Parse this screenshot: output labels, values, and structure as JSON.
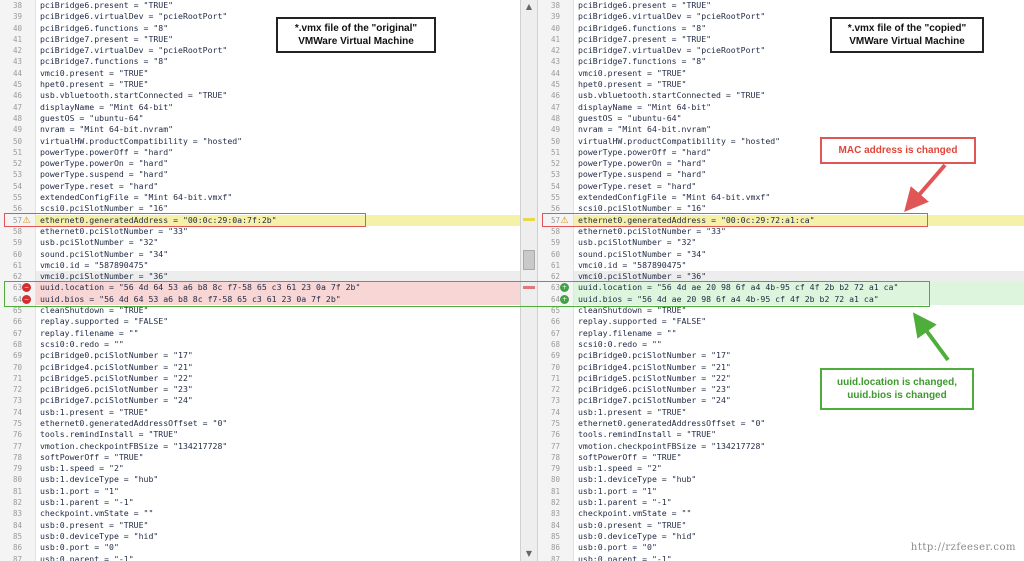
{
  "left": {
    "lines": [
      {
        "n": "38",
        "t": "pciBridge6.present = \"TRUE\"",
        "s": "",
        "m": ""
      },
      {
        "n": "39",
        "t": "pciBridge6.virtualDev = \"pcieRootPort\"",
        "s": "",
        "m": ""
      },
      {
        "n": "40",
        "t": "pciBridge6.functions = \"8\"",
        "s": "",
        "m": ""
      },
      {
        "n": "41",
        "t": "pciBridge7.present = \"TRUE\"",
        "s": "",
        "m": ""
      },
      {
        "n": "42",
        "t": "pciBridge7.virtualDev = \"pcieRootPort\"",
        "s": "",
        "m": ""
      },
      {
        "n": "43",
        "t": "pciBridge7.functions = \"8\"",
        "s": "",
        "m": ""
      },
      {
        "n": "44",
        "t": "vmci0.present = \"TRUE\"",
        "s": "",
        "m": ""
      },
      {
        "n": "45",
        "t": "hpet0.present = \"TRUE\"",
        "s": "",
        "m": ""
      },
      {
        "n": "46",
        "t": "usb.vbluetooth.startConnected = \"TRUE\"",
        "s": "",
        "m": ""
      },
      {
        "n": "47",
        "t": "displayName = \"Mint 64-bit\"",
        "s": "",
        "m": ""
      },
      {
        "n": "48",
        "t": "guestOS = \"ubuntu-64\"",
        "s": "",
        "m": ""
      },
      {
        "n": "49",
        "t": "nvram = \"Mint 64-bit.nvram\"",
        "s": "",
        "m": ""
      },
      {
        "n": "50",
        "t": "virtualHW.productCompatibility = \"hosted\"",
        "s": "",
        "m": ""
      },
      {
        "n": "51",
        "t": "powerType.powerOff = \"hard\"",
        "s": "",
        "m": ""
      },
      {
        "n": "52",
        "t": "powerType.powerOn = \"hard\"",
        "s": "",
        "m": ""
      },
      {
        "n": "53",
        "t": "powerType.suspend = \"hard\"",
        "s": "",
        "m": ""
      },
      {
        "n": "54",
        "t": "powerType.reset = \"hard\"",
        "s": "",
        "m": ""
      },
      {
        "n": "55",
        "t": "extendedConfigFile = \"Mint 64-bit.vmxf\"",
        "s": "",
        "m": ""
      },
      {
        "n": "56",
        "t": "scsi0.pciSlotNumber = \"16\"",
        "s": "",
        "m": ""
      },
      {
        "n": "57",
        "t": "ethernet0.generatedAddress = \"00:0c:29:0a:7f:2b\"",
        "s": "yellow",
        "m": "warn"
      },
      {
        "n": "58",
        "t": "ethernet0.pciSlotNumber = \"33\"",
        "s": "",
        "m": ""
      },
      {
        "n": "59",
        "t": "usb.pciSlotNumber = \"32\"",
        "s": "",
        "m": ""
      },
      {
        "n": "60",
        "t": "sound.pciSlotNumber = \"34\"",
        "s": "",
        "m": ""
      },
      {
        "n": "61",
        "t": "vmci0.id = \"587890475\"",
        "s": "",
        "m": ""
      },
      {
        "n": "62",
        "t": "vmci0.pciSlotNumber = \"36\"",
        "s": "grey",
        "m": ""
      },
      {
        "n": "63",
        "t": "uuid.location = \"56 4d 64 53 a6 b8 8c f7-58 65 c3 61 23 0a 7f 2b\"",
        "s": "pink",
        "m": "removed"
      },
      {
        "n": "64",
        "t": "uuid.bios = \"56 4d 64 53 a6 b8 8c f7-58 65 c3 61 23 0a 7f 2b\"",
        "s": "pink",
        "m": "removed"
      },
      {
        "n": "65",
        "t": "cleanShutdown = \"TRUE\"",
        "s": "",
        "m": ""
      },
      {
        "n": "66",
        "t": "replay.supported = \"FALSE\"",
        "s": "",
        "m": ""
      },
      {
        "n": "67",
        "t": "replay.filename = \"\"",
        "s": "",
        "m": ""
      },
      {
        "n": "68",
        "t": "scsi0:0.redo = \"\"",
        "s": "",
        "m": ""
      },
      {
        "n": "69",
        "t": "pciBridge0.pciSlotNumber = \"17\"",
        "s": "",
        "m": ""
      },
      {
        "n": "70",
        "t": "pciBridge4.pciSlotNumber = \"21\"",
        "s": "",
        "m": ""
      },
      {
        "n": "71",
        "t": "pciBridge5.pciSlotNumber = \"22\"",
        "s": "",
        "m": ""
      },
      {
        "n": "72",
        "t": "pciBridge6.pciSlotNumber = \"23\"",
        "s": "",
        "m": ""
      },
      {
        "n": "73",
        "t": "pciBridge7.pciSlotNumber = \"24\"",
        "s": "",
        "m": ""
      },
      {
        "n": "74",
        "t": "usb:1.present = \"TRUE\"",
        "s": "",
        "m": ""
      },
      {
        "n": "75",
        "t": "ethernet0.generatedAddressOffset = \"0\"",
        "s": "",
        "m": ""
      },
      {
        "n": "76",
        "t": "tools.remindInstall = \"TRUE\"",
        "s": "",
        "m": ""
      },
      {
        "n": "77",
        "t": "vmotion.checkpointFBSize = \"134217728\"",
        "s": "",
        "m": ""
      },
      {
        "n": "78",
        "t": "softPowerOff = \"TRUE\"",
        "s": "",
        "m": ""
      },
      {
        "n": "79",
        "t": "usb:1.speed = \"2\"",
        "s": "",
        "m": ""
      },
      {
        "n": "80",
        "t": "usb:1.deviceType = \"hub\"",
        "s": "",
        "m": ""
      },
      {
        "n": "81",
        "t": "usb:1.port = \"1\"",
        "s": "",
        "m": ""
      },
      {
        "n": "82",
        "t": "usb:1.parent = \"-1\"",
        "s": "",
        "m": ""
      },
      {
        "n": "83",
        "t": "checkpoint.vmState = \"\"",
        "s": "",
        "m": ""
      },
      {
        "n": "84",
        "t": "usb:0.present = \"TRUE\"",
        "s": "",
        "m": ""
      },
      {
        "n": "85",
        "t": "usb:0.deviceType = \"hid\"",
        "s": "",
        "m": ""
      },
      {
        "n": "86",
        "t": "usb:0.port = \"0\"",
        "s": "",
        "m": ""
      },
      {
        "n": "87",
        "t": "usb:0.parent = \"-1\"",
        "s": "",
        "m": ""
      }
    ]
  },
  "right": {
    "lines": [
      {
        "n": "38",
        "t": "pciBridge6.present = \"TRUE\"",
        "s": "",
        "m": ""
      },
      {
        "n": "39",
        "t": "pciBridge6.virtualDev = \"pcieRootPort\"",
        "s": "",
        "m": ""
      },
      {
        "n": "40",
        "t": "pciBridge6.functions = \"8\"",
        "s": "",
        "m": ""
      },
      {
        "n": "41",
        "t": "pciBridge7.present = \"TRUE\"",
        "s": "",
        "m": ""
      },
      {
        "n": "42",
        "t": "pciBridge7.virtualDev = \"pcieRootPort\"",
        "s": "",
        "m": ""
      },
      {
        "n": "43",
        "t": "pciBridge7.functions = \"8\"",
        "s": "",
        "m": ""
      },
      {
        "n": "44",
        "t": "vmci0.present = \"TRUE\"",
        "s": "",
        "m": ""
      },
      {
        "n": "45",
        "t": "hpet0.present = \"TRUE\"",
        "s": "",
        "m": ""
      },
      {
        "n": "46",
        "t": "usb.vbluetooth.startConnected = \"TRUE\"",
        "s": "",
        "m": ""
      },
      {
        "n": "47",
        "t": "displayName = \"Mint 64-bit\"",
        "s": "",
        "m": ""
      },
      {
        "n": "48",
        "t": "guestOS = \"ubuntu-64\"",
        "s": "",
        "m": ""
      },
      {
        "n": "49",
        "t": "nvram = \"Mint 64-bit.nvram\"",
        "s": "",
        "m": ""
      },
      {
        "n": "50",
        "t": "virtualHW.productCompatibility = \"hosted\"",
        "s": "",
        "m": ""
      },
      {
        "n": "51",
        "t": "powerType.powerOff = \"hard\"",
        "s": "",
        "m": ""
      },
      {
        "n": "52",
        "t": "powerType.powerOn = \"hard\"",
        "s": "",
        "m": ""
      },
      {
        "n": "53",
        "t": "powerType.suspend = \"hard\"",
        "s": "",
        "m": ""
      },
      {
        "n": "54",
        "t": "powerType.reset = \"hard\"",
        "s": "",
        "m": ""
      },
      {
        "n": "55",
        "t": "extendedConfigFile = \"Mint 64-bit.vmxf\"",
        "s": "",
        "m": ""
      },
      {
        "n": "56",
        "t": "scsi0.pciSlotNumber = \"16\"",
        "s": "",
        "m": ""
      },
      {
        "n": "57",
        "t": "ethernet0.generatedAddress = \"00:0c:29:72:a1:ca\"",
        "s": "yellow",
        "m": "warn"
      },
      {
        "n": "58",
        "t": "ethernet0.pciSlotNumber = \"33\"",
        "s": "",
        "m": ""
      },
      {
        "n": "59",
        "t": "usb.pciSlotNumber = \"32\"",
        "s": "",
        "m": ""
      },
      {
        "n": "60",
        "t": "sound.pciSlotNumber = \"34\"",
        "s": "",
        "m": ""
      },
      {
        "n": "61",
        "t": "vmci0.id = \"587890475\"",
        "s": "",
        "m": ""
      },
      {
        "n": "62",
        "t": "vmci0.pciSlotNumber = \"36\"",
        "s": "grey",
        "m": ""
      },
      {
        "n": "63",
        "t": "uuid.location = \"56 4d ae 20 98 6f a4 4b-95 cf 4f 2b b2 72 a1 ca\"",
        "s": "green",
        "m": "added"
      },
      {
        "n": "64",
        "t": "uuid.bios = \"56 4d ae 20 98 6f a4 4b-95 cf 4f 2b b2 72 a1 ca\"",
        "s": "green",
        "m": "added"
      },
      {
        "n": "65",
        "t": "cleanShutdown = \"TRUE\"",
        "s": "",
        "m": ""
      },
      {
        "n": "66",
        "t": "replay.supported = \"FALSE\"",
        "s": "",
        "m": ""
      },
      {
        "n": "67",
        "t": "replay.filename = \"\"",
        "s": "",
        "m": ""
      },
      {
        "n": "68",
        "t": "scsi0:0.redo = \"\"",
        "s": "",
        "m": ""
      },
      {
        "n": "69",
        "t": "pciBridge0.pciSlotNumber = \"17\"",
        "s": "",
        "m": ""
      },
      {
        "n": "70",
        "t": "pciBridge4.pciSlotNumber = \"21\"",
        "s": "",
        "m": ""
      },
      {
        "n": "71",
        "t": "pciBridge5.pciSlotNumber = \"22\"",
        "s": "",
        "m": ""
      },
      {
        "n": "72",
        "t": "pciBridge6.pciSlotNumber = \"23\"",
        "s": "",
        "m": ""
      },
      {
        "n": "73",
        "t": "pciBridge7.pciSlotNumber = \"24\"",
        "s": "",
        "m": ""
      },
      {
        "n": "74",
        "t": "usb:1.present = \"TRUE\"",
        "s": "",
        "m": ""
      },
      {
        "n": "75",
        "t": "ethernet0.generatedAddressOffset = \"0\"",
        "s": "",
        "m": ""
      },
      {
        "n": "76",
        "t": "tools.remindInstall = \"TRUE\"",
        "s": "",
        "m": ""
      },
      {
        "n": "77",
        "t": "vmotion.checkpointFBSize = \"134217728\"",
        "s": "",
        "m": ""
      },
      {
        "n": "78",
        "t": "softPowerOff = \"TRUE\"",
        "s": "",
        "m": ""
      },
      {
        "n": "79",
        "t": "usb:1.speed = \"2\"",
        "s": "",
        "m": ""
      },
      {
        "n": "80",
        "t": "usb:1.deviceType = \"hub\"",
        "s": "",
        "m": ""
      },
      {
        "n": "81",
        "t": "usb:1.port = \"1\"",
        "s": "",
        "m": ""
      },
      {
        "n": "82",
        "t": "usb:1.parent = \"-1\"",
        "s": "",
        "m": ""
      },
      {
        "n": "83",
        "t": "checkpoint.vmState = \"\"",
        "s": "",
        "m": ""
      },
      {
        "n": "84",
        "t": "usb:0.present = \"TRUE\"",
        "s": "",
        "m": ""
      },
      {
        "n": "85",
        "t": "usb:0.deviceType = \"hid\"",
        "s": "",
        "m": ""
      },
      {
        "n": "86",
        "t": "usb:0.port = \"0\"",
        "s": "",
        "m": ""
      },
      {
        "n": "87",
        "t": "usb:0.parent = \"-1\"",
        "s": "",
        "m": ""
      }
    ]
  },
  "annotations": {
    "original_label": "*.vmx file of the \"original\"\nVMWare Virtual Machine",
    "copied_label": "*.vmx file of the \"copied\"\nVMWare Virtual Machine",
    "mac_note": "MAC address is changed",
    "uuid_note": "uuid.location is changed,\nuuid.bios is changed"
  },
  "watermark": "http://rzfeeser.com",
  "colors": {
    "changed_line": "#f6f1a8",
    "removed_line": "#f9d6d6",
    "added_line": "#ddf5dc",
    "red_annotation": "#e05555",
    "green_annotation": "#4fae3b"
  },
  "icons": {
    "warn": "warning-triangle-icon",
    "changed": "diff-changed-icon",
    "removed": "diff-removed-icon",
    "added": "diff-added-icon"
  }
}
